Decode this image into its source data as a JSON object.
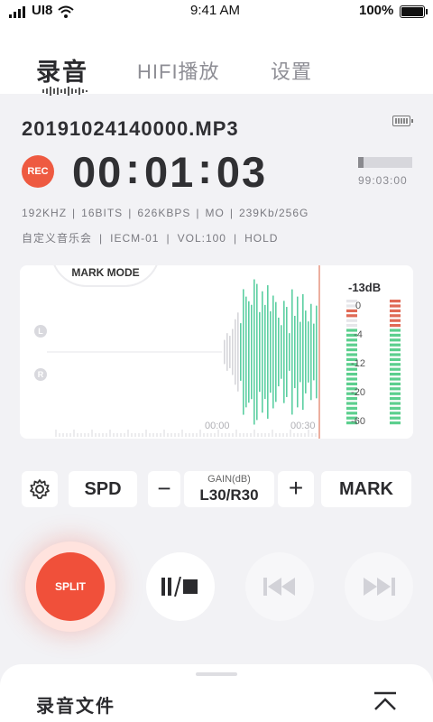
{
  "status_bar": {
    "carrier": "UI8",
    "time": "9:41 AM",
    "battery": "100%"
  },
  "tabs": [
    {
      "label": "录音",
      "active": true
    },
    {
      "label": "HIFI播放",
      "active": false
    },
    {
      "label": "设置",
      "active": false
    }
  ],
  "recording": {
    "filename": "20191024140000.MP3",
    "rec_badge": "REC",
    "timer": {
      "h": "00",
      "m": "01",
      "s": "03"
    },
    "remaining_time": "99:03:00",
    "storage_used_fraction": 0.1,
    "specs_line1": [
      "192KHZ",
      "16BITS",
      "626KBPS",
      "MO",
      "239Kb/256G"
    ],
    "specs_line2": [
      "自定义音乐会",
      "IECM-01",
      "VOL:100",
      "HOLD"
    ]
  },
  "waveform": {
    "mark_mode_label": "MARK MODE",
    "channel_left": "L",
    "channel_right": "R",
    "time_labels": [
      "00:00",
      "00:30"
    ],
    "level_readout": "-13dB",
    "meter_labels": [
      "0",
      "-4",
      "-12",
      "-20",
      "-60"
    ]
  },
  "controls": {
    "spd_label": "SPD",
    "minus_label": "−",
    "gain_title": "GAIN(dB)",
    "gain_value": "L30/R30",
    "plus_label": "+",
    "mark_label": "MARK"
  },
  "transport": {
    "split_label": "SPLIT"
  },
  "bottom_sheet": {
    "title": "录音文件"
  },
  "icons": {
    "signal": "signal-bars-icon",
    "wifi": "wifi-icon",
    "battery": "battery-icon",
    "settings": "gear-icon",
    "pause_stop": "pause-stop-icon",
    "previous": "skip-previous-icon",
    "next": "skip-next-icon",
    "collapse": "chevron-up-double-icon"
  },
  "colors": {
    "accent_red": "#f0503a",
    "wave_green": "#5ccfa2",
    "wave_gray": "#d6d6da",
    "meter_red": "#e06a56",
    "background": "#f2f2f5"
  }
}
